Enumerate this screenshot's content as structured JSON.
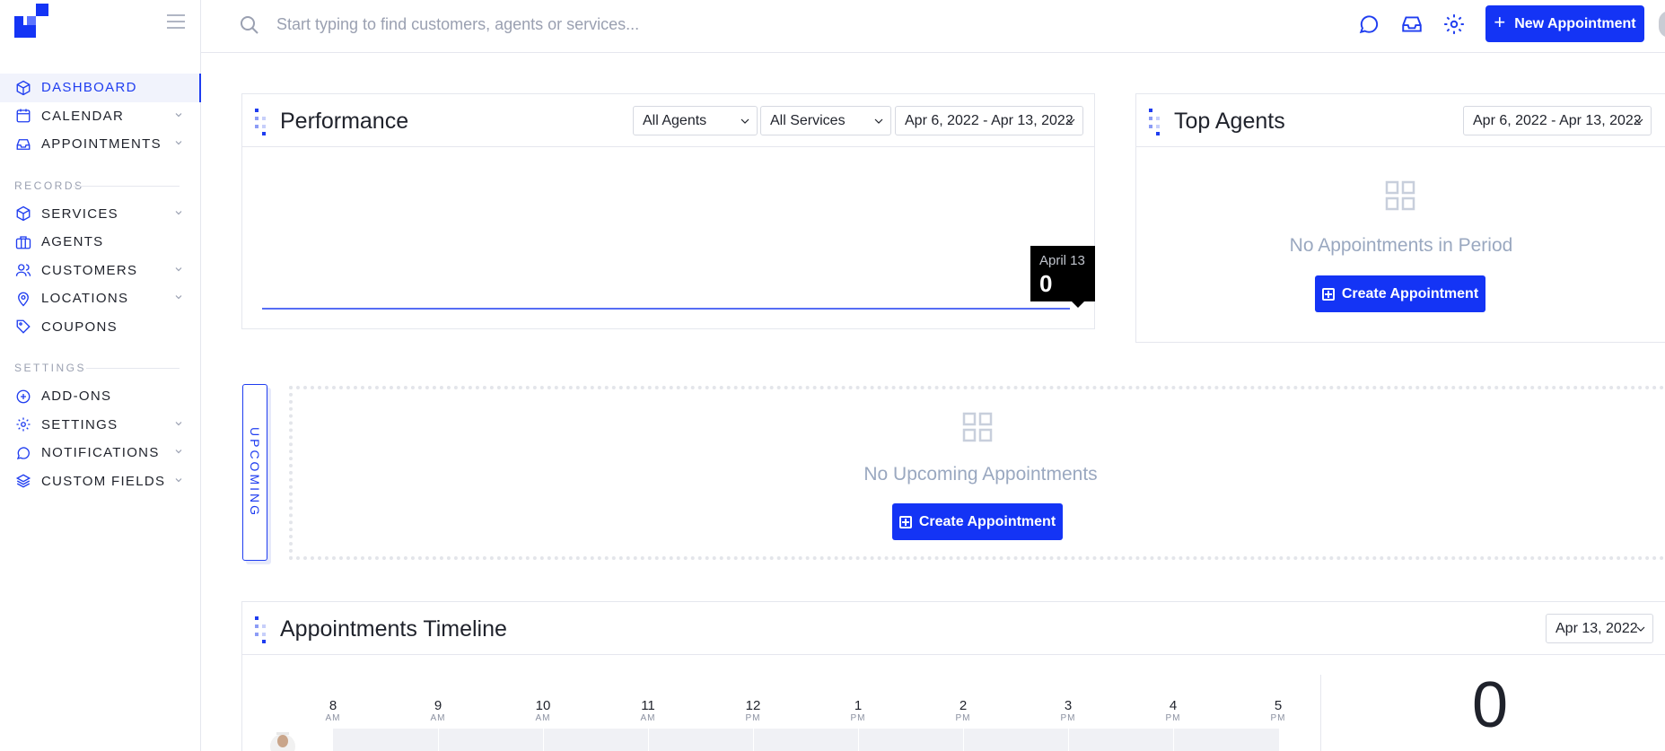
{
  "sidebar": {
    "nav": [
      {
        "label": "DASHBOARD",
        "icon": "box-icon",
        "active": true
      },
      {
        "label": "CALENDAR",
        "icon": "calendar-icon",
        "chevron": true
      },
      {
        "label": "APPOINTMENTS",
        "icon": "inbox-icon",
        "chevron": true
      }
    ],
    "records_label": "RECORDS",
    "records": [
      {
        "label": "SERVICES",
        "icon": "box-icon",
        "chevron": true
      },
      {
        "label": "AGENTS",
        "icon": "briefcase-icon"
      },
      {
        "label": "CUSTOMERS",
        "icon": "users-icon",
        "chevron": true
      },
      {
        "label": "LOCATIONS",
        "icon": "map-pin-icon",
        "chevron": true
      },
      {
        "label": "COUPONS",
        "icon": "tag-icon"
      }
    ],
    "settings_label": "SETTINGS",
    "settings": [
      {
        "label": "ADD-ONS",
        "icon": "plus-circle-icon"
      },
      {
        "label": "SETTINGS",
        "icon": "gear-icon",
        "chevron": true
      },
      {
        "label": "NOTIFICATIONS",
        "icon": "chat-icon",
        "chevron": true
      },
      {
        "label": "CUSTOM FIELDS",
        "icon": "layers-icon",
        "chevron": true
      }
    ]
  },
  "topbar": {
    "search_placeholder": "Start typing to find customers, agents or services...",
    "new_appointment_label": "New Appointment"
  },
  "performance": {
    "title": "Performance",
    "agents_filter": "All Agents",
    "services_filter": "All Services",
    "date_range": "Apr 6, 2022 - Apr 13, 2022",
    "tooltip_date": "April 13",
    "tooltip_value": "0"
  },
  "top_agents": {
    "title": "Top Agents",
    "date_range": "Apr 6, 2022 - Apr 13, 2022",
    "empty_text": "No Appointments in Period",
    "create_label": "Create Appointment"
  },
  "upcoming": {
    "tab_label": "UPCOMING",
    "empty_text": "No Upcoming Appointments",
    "create_label": "Create Appointment"
  },
  "timeline": {
    "title": "Appointments Timeline",
    "date": "Apr 13, 2022",
    "hours": [
      {
        "h": "8",
        "ap": "AM"
      },
      {
        "h": "9",
        "ap": "AM"
      },
      {
        "h": "10",
        "ap": "AM"
      },
      {
        "h": "11",
        "ap": "AM"
      },
      {
        "h": "12",
        "ap": "PM"
      },
      {
        "h": "1",
        "ap": "PM"
      },
      {
        "h": "2",
        "ap": "PM"
      },
      {
        "h": "3",
        "ap": "PM"
      },
      {
        "h": "4",
        "ap": "PM"
      },
      {
        "h": "5",
        "ap": "PM"
      }
    ],
    "total": "0"
  },
  "colors": {
    "accent": "#1434f5",
    "muted": "#9aa8c0"
  }
}
